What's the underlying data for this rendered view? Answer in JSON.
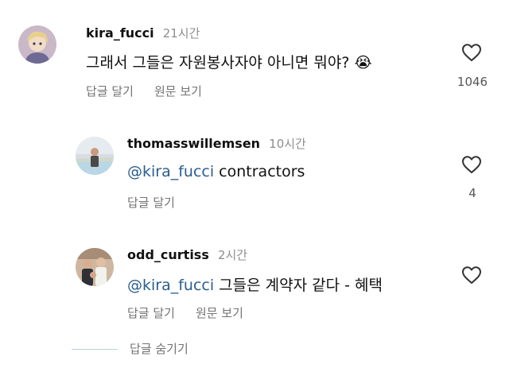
{
  "comments": [
    {
      "username": "kira_fucci",
      "time": "21시간",
      "text": "그래서 그들은 자원봉사자야 아니면 뭐야? 😭",
      "mention": "",
      "actions": [
        "답글 달기",
        "원문 보기"
      ],
      "likes": "1046",
      "avatar_icon": "anime-avatar"
    },
    {
      "username": "thomasswillemsen",
      "time": "10시간",
      "mention": "@kira_fucci",
      "text": " contractors",
      "actions": [
        "답글 달기"
      ],
      "likes": "4",
      "avatar_icon": "beach-photo-avatar"
    },
    {
      "username": "odd_curtiss",
      "time": "2시간",
      "mention": "@kira_fucci",
      "text": " 그들은 계약자 같다 - 혜택",
      "actions": [
        "답글 달기",
        "원문 보기"
      ],
      "likes": "",
      "avatar_icon": "group-photo-avatar"
    }
  ],
  "hide_replies_label": "답글 숨기기",
  "colors": {
    "mention": "#2a5d8f",
    "secondary_text": "#737373",
    "timestamp": "#8e8e8e",
    "divider_line": "#b8d3d8"
  }
}
